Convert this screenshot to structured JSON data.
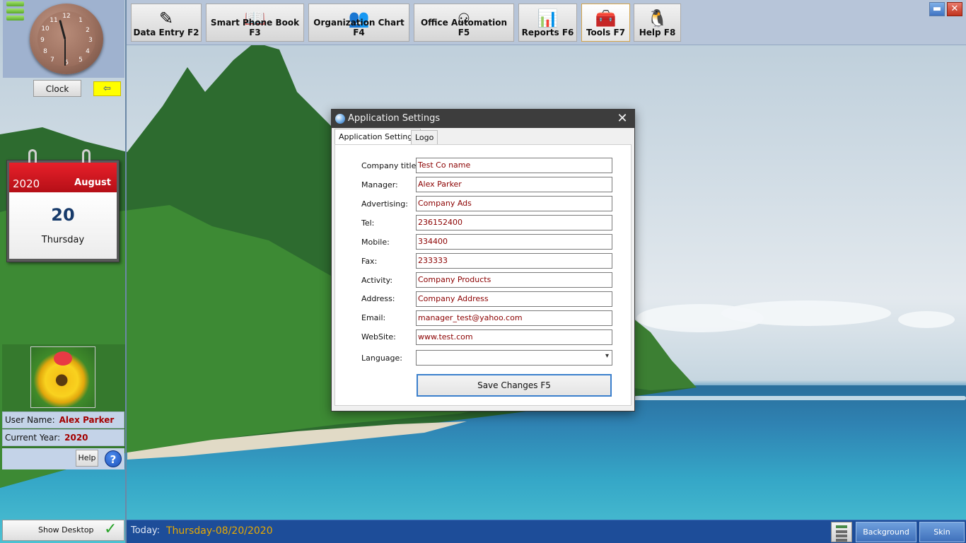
{
  "toolbar": {
    "buttons": [
      {
        "label": "Data Entry F2",
        "icon": "pencil-paper-icon"
      },
      {
        "label": "Smart Phone Book F3",
        "icon": "book-icon"
      },
      {
        "label": "Organization Chart F4",
        "icon": "people-icon"
      },
      {
        "label": "Office Automation F5",
        "icon": "org-tree-icon"
      },
      {
        "label": "Reports F6",
        "icon": "chart-icon"
      },
      {
        "label": "Tools F7",
        "icon": "tools-box-icon"
      },
      {
        "label": "Help F8",
        "icon": "penguin-icon"
      }
    ],
    "active": "Tools F7"
  },
  "sidebar": {
    "clock_label": "Clock",
    "clock_time": "11:30",
    "calendar": {
      "year": "2020",
      "month": "August",
      "day": "20",
      "weekday": "Thursday"
    },
    "user_name_label": "User Name:",
    "user_name": "Alex Parker",
    "current_year_label": "Current Year:",
    "current_year": "2020",
    "help_label": "Help",
    "help_icon": "?",
    "show_desktop_label": "Show Desktop"
  },
  "statusbar": {
    "today_label": "Today:",
    "today_value": "Thursday-08/20/2020",
    "background_label": "Background",
    "skin_label": "Skin"
  },
  "dialog": {
    "title": "Application Settings",
    "tabs": [
      "Application Settings",
      "Logo"
    ],
    "active_tab": "Application Settings",
    "fields": {
      "company_title": {
        "label": "Company title:",
        "value": "Test Co name"
      },
      "manager": {
        "label": "Manager:",
        "value": "Alex Parker"
      },
      "advertising": {
        "label": "Advertising:",
        "value": "Company Ads"
      },
      "tel": {
        "label": "Tel:",
        "value": "236152400"
      },
      "mobile": {
        "label": "Mobile:",
        "value": "334400"
      },
      "fax": {
        "label": "Fax:",
        "value": "233333"
      },
      "activity": {
        "label": "Activity:",
        "value": "Company Products"
      },
      "address": {
        "label": "Address:",
        "value": "Company Address"
      },
      "email": {
        "label": "Email:",
        "value": "manager_test@yahoo.com"
      },
      "website": {
        "label": "WebSite:",
        "value": "www.test.com"
      },
      "language": {
        "label": "Language:",
        "value": ""
      }
    },
    "save_label": "Save Changes F5"
  },
  "colors": {
    "accent": "#3b7fcc",
    "status_bar": "#1d4d99",
    "input_text": "#8b0000",
    "date_text": "#e8a900"
  }
}
